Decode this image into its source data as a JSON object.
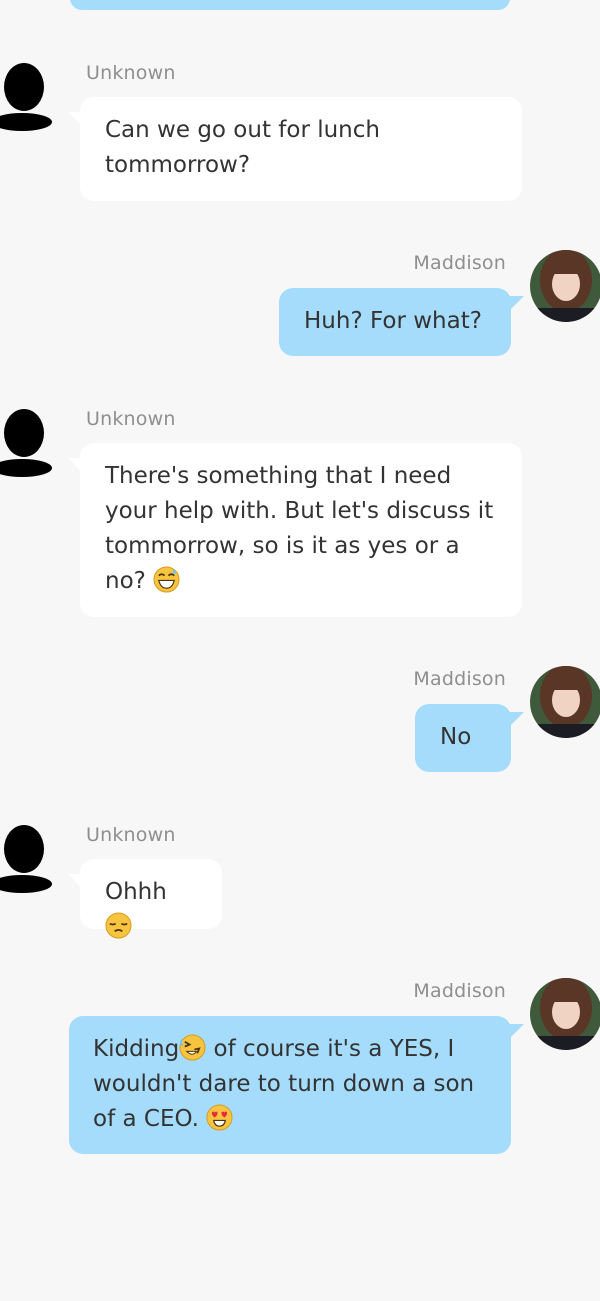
{
  "messages": [
    {
      "sender": "Unknown",
      "side": "in",
      "text": "Can we go out for lunch tommorrow?",
      "emoji": ""
    },
    {
      "sender": "Maddison",
      "side": "out",
      "text": "Huh? For what?",
      "emoji": ""
    },
    {
      "sender": "Unknown",
      "side": "in",
      "text": "There's something that I need your help with. But let's discuss it tommorrow, so is it as yes or a no?",
      "emoji": "grinning-sweat-emoji"
    },
    {
      "sender": "Maddison",
      "side": "out",
      "text": "No",
      "emoji": ""
    },
    {
      "sender": "Unknown",
      "side": "in",
      "text": "Ohhh",
      "emoji": "pensive-emoji"
    },
    {
      "sender": "Maddison",
      "side": "out",
      "text_a": "Kidding",
      "text_b": " of course it's a YES, I wouldn't dare to turn down a son of a CEO.",
      "emoji_a": "rofl-emoji",
      "emoji_b": "heart-eyes-emoji"
    }
  ],
  "colors": {
    "background": "#f7f7f7",
    "incoming_bubble": "#ffffff",
    "outgoing_bubble": "#a5dcfb",
    "sender_name": "#8f8f8f",
    "text": "#333333"
  },
  "icons": {
    "unknown_avatar": "person-silhouette-icon",
    "maddison_avatar": "user-photo-avatar"
  }
}
